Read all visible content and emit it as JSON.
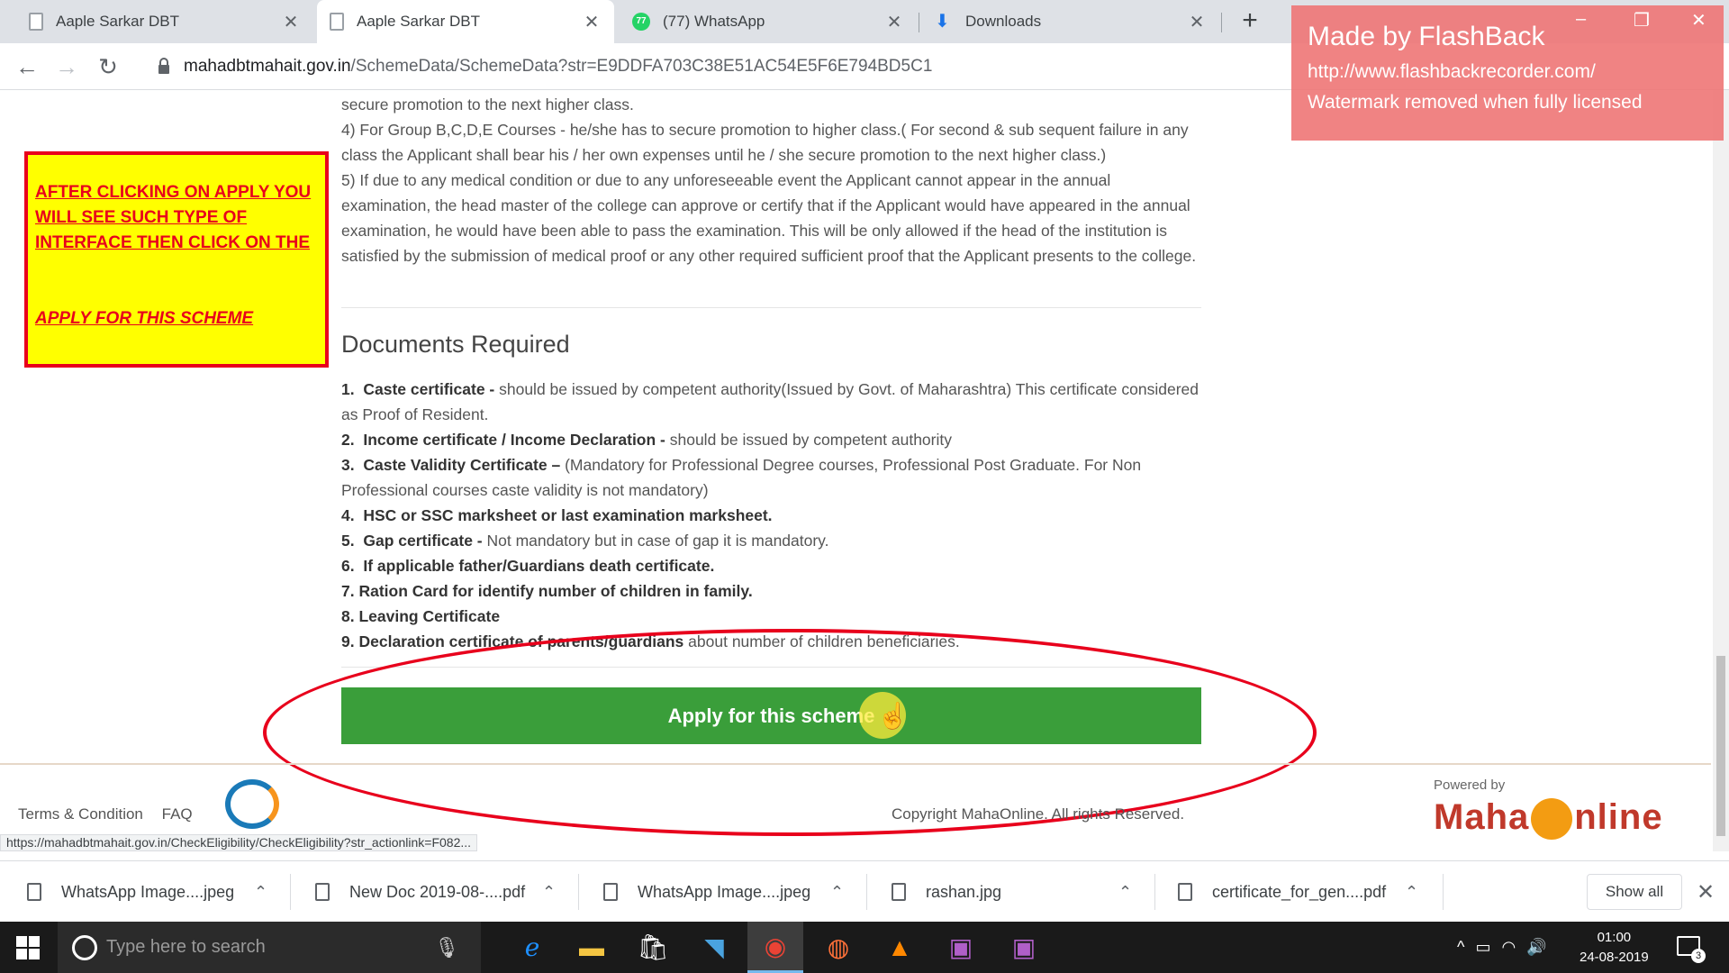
{
  "browser": {
    "tabs": [
      {
        "title": "Aaple Sarkar DBT",
        "icon": "document-icon"
      },
      {
        "title": "Aaple Sarkar DBT",
        "icon": "document-icon"
      },
      {
        "title": "(77) WhatsApp",
        "icon": "whatsapp-icon",
        "badge": "77"
      },
      {
        "title": "Downloads",
        "icon": "download-icon"
      }
    ],
    "new_tab_symbol": "+",
    "url_host": "mahadbtmahait.gov.in",
    "url_path": "/SchemeData/SchemeData?str=E9DDFA703C38E51AC54E5F6E794BD5C1"
  },
  "watermark": {
    "title": "Made by FlashBack",
    "url": "http://www.flashbackrecorder.com/",
    "note": "Watermark removed when fully licensed"
  },
  "callout": {
    "line1": "AFTER CLICKING ON APPLY YOU WILL SEE SUCH TYPE OF INTERFACE THEN CLICK ON THE",
    "line2": "APPLY FOR THIS SCHEME"
  },
  "rules": {
    "p0": "secure promotion to the next higher class.",
    "p4": "4) For Group B,C,D,E Courses - he/she has to secure promotion to higher class.( For second & sub sequent failure in any class the Applicant shall bear his / her own expenses until he / she secure promotion to the next higher class.)",
    "p5": "5) If due to any medical condition or due to any unforeseeable event the Applicant cannot appear in the annual examination, the head master of the college can approve or certify that if the Applicant would have appeared in the annual examination, he would have been able to pass the examination. This will be only allowed if the head of the institution is satisfied by the submission of medical proof or any other required sufficient proof that the Applicant presents to the college."
  },
  "documents": {
    "heading": "Documents Required",
    "items": [
      {
        "num": "1.",
        "bold": "Caste certificate -",
        "text": " should be issued by competent authority(Issued by Govt. of Maharashtra) This certificate considered as Proof of Resident."
      },
      {
        "num": "2.",
        "bold": "Income certificate / Income Declaration -",
        "text": " should be issued by competent authority"
      },
      {
        "num": "3.",
        "bold": "Caste Validity Certificate –",
        "text": " (Mandatory for Professional Degree courses, Professional Post Graduate. For Non Professional courses caste validity is not mandatory)"
      },
      {
        "num": "4.",
        "bold": "HSC or SSC marksheet or last examination marksheet.",
        "text": ""
      },
      {
        "num": "5.",
        "bold": "Gap certificate -",
        "text": " Not mandatory but in case of gap it is mandatory."
      },
      {
        "num": "6.",
        "bold": "If applicable father/Guardians death certificate.",
        "text": ""
      },
      {
        "num": "7.",
        "bold": "Ration Card for identify number of children in family.",
        "text": ""
      },
      {
        "num": "8.",
        "bold": "Leaving Certificate",
        "text": ""
      },
      {
        "num": "9.",
        "bold": "Declaration certificate of parents/guardians",
        "text": " about number of children beneficiaries."
      }
    ],
    "apply_button": "Apply for this scheme"
  },
  "footer": {
    "terms": "Terms & Condition",
    "faq": "FAQ",
    "copyright": "Copyright MahaOnline. All rights Reserved.",
    "powered_by": "Powered by",
    "maha_left": "Maha",
    "maha_right": "nline",
    "status_url": "https://mahadbtmahait.gov.in/CheckEligibility/CheckEligibility?str_actionlink=F082..."
  },
  "downloads": {
    "items": [
      "WhatsApp Image....jpeg",
      "New Doc 2019-08-....pdf",
      "WhatsApp Image....jpeg",
      "rashan.jpg",
      "certificate_for_gen....pdf"
    ],
    "show_all": "Show all"
  },
  "taskbar": {
    "search_placeholder": "Type here to search",
    "time": "01:00",
    "date": "24-08-2019",
    "notification_count": "3"
  },
  "colors": {
    "apply_button": "#3a9e3a",
    "callout_bg": "#ffff00",
    "callout_text": "#e8001c",
    "watermark_bg": "#ee7676"
  }
}
